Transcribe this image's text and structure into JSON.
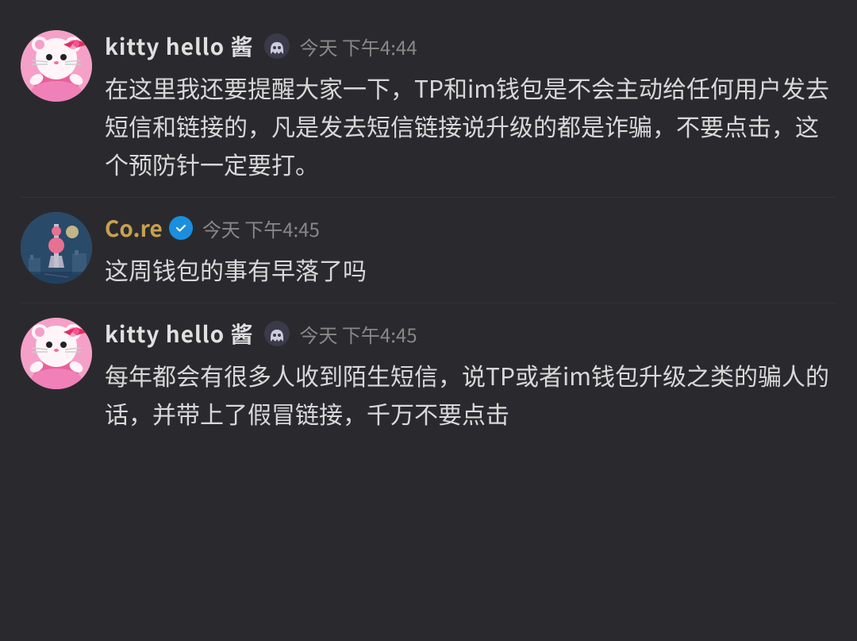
{
  "messages": [
    {
      "id": "msg1",
      "username": "kitty  hello  酱",
      "has_ghost_icon": true,
      "timestamp": "今天 下午4:44",
      "text": "在这里我还要提醒大家一下，TP和im钱包是不会主动给任何用户发去短信和链接的，凡是发去短信链接说升级的都是诈骗，不要点击，这个预防针一定要打。",
      "avatar_type": "kitty"
    },
    {
      "id": "msg2",
      "username": "Co.re",
      "has_verified": true,
      "timestamp": "今天 下午4:45",
      "text": "这周钱包的事有早落了吗",
      "avatar_type": "core"
    },
    {
      "id": "msg3",
      "username": "kitty  hello  酱",
      "has_ghost_icon": true,
      "timestamp": "今天 下午4:45",
      "text": "每年都会有很多人收到陌生短信，说TP或者im钱包升级之类的骗人的话，并带上了假冒链接，千万不要点击",
      "avatar_type": "kitty"
    }
  ]
}
